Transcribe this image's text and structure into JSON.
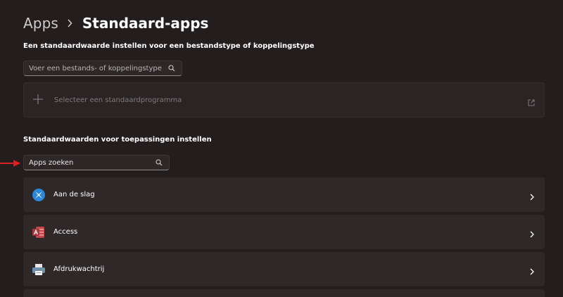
{
  "breadcrumb": {
    "parent": "Apps",
    "current": "Standaard-apps"
  },
  "file_type_section": {
    "title": "Een standaardwaarde instellen voor een bestandstype of koppelingstype",
    "search_placeholder": "Voer een bestands- of koppelingstype in",
    "default_program_label": "Selecteer een standaardprogramma"
  },
  "apps_section": {
    "title": "Standaardwaarden voor toepassingen instellen",
    "search_value": "Apps zoeken"
  },
  "apps": [
    {
      "label": "Aan de slag",
      "icon": "get-started-icon"
    },
    {
      "label": "Access",
      "icon": "access-icon"
    },
    {
      "label": "Afdrukwachtrij",
      "icon": "print-queue-icon"
    }
  ],
  "colors": {
    "background": "#231d1e",
    "card": "#2e2829",
    "annotation_arrow": "#e0201c",
    "access_red": "#a4373a",
    "get_started_blue": "#2b88d8"
  }
}
